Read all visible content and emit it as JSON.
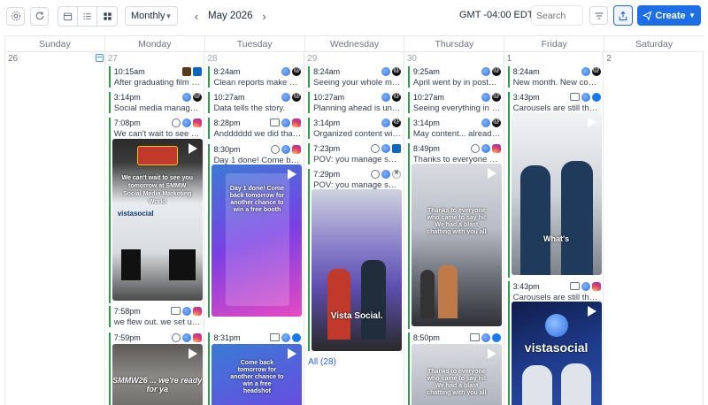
{
  "toolbar": {
    "view_select": "Monthly",
    "month": "May 2026",
    "timezone": "GMT -04:00 EDT",
    "search_placeholder": "Search",
    "create_label": "Create"
  },
  "weekdays": [
    "Sunday",
    "Monday",
    "Tuesday",
    "Wednesday",
    "Thursday",
    "Friday",
    "Saturday"
  ],
  "days": [
    {
      "num": "26",
      "posts": []
    },
    {
      "num": "27",
      "posts": [
        {
          "time": "10:15am",
          "text": "After graduating film scho..."
        },
        {
          "time": "3:14pm",
          "text": "Social media managers ar..."
        },
        {
          "time": "7:08pm",
          "text": "We can't wait to see you t..."
        },
        {
          "time": "7:58pm",
          "text": "we flew out. we set up. w..."
        },
        {
          "time": "7:59pm",
          "text": ""
        }
      ]
    },
    {
      "num": "28",
      "posts": [
        {
          "time": "8:24am",
          "text": "Clean reports make you lo..."
        },
        {
          "time": "10:27am",
          "text": "Data tells the story."
        },
        {
          "time": "8:28pm",
          "text": "Andddddd we did that #S..."
        },
        {
          "time": "8:30pm",
          "text": "Day 1 done! Come back to..."
        },
        {
          "time": "8:31pm",
          "text": ""
        }
      ]
    },
    {
      "num": "29",
      "posts": [
        {
          "time": "8:24am",
          "text": "Seeing your whole month ..."
        },
        {
          "time": "10:27am",
          "text": "Planning ahead is underra..."
        },
        {
          "time": "3:14pm",
          "text": "Organized content wins."
        },
        {
          "time": "7:23pm",
          "text": "POV: you manage so man..."
        },
        {
          "time": "7:29pm",
          "text": "POV: you manage so man..."
        }
      ],
      "all_link": "All (28)"
    },
    {
      "num": "30",
      "posts": [
        {
          "time": "9:25am",
          "text": "April went by in posts, me..."
        },
        {
          "time": "10:27am",
          "text": "Seeing everything in one ..."
        },
        {
          "time": "3:14pm",
          "text": "May content... already sch..."
        },
        {
          "time": "8:49pm",
          "text": "Thanks to everyone who c..."
        },
        {
          "time": "8:50pm",
          "text": ""
        }
      ]
    },
    {
      "num": "1",
      "posts": [
        {
          "time": "8:24am",
          "text": "New month. New content ..."
        },
        {
          "time": "3:43pm",
          "text": "Carousels are still the mo..."
        },
        {
          "time": "3:43pm",
          "text": "Carousels are still the mo..."
        }
      ]
    },
    {
      "num": "2",
      "posts": []
    }
  ],
  "thumb_text": {
    "mon_booth": "We can't wait to see you tomorrow at SMMW Social Media Marketing World",
    "mon_sign": "vistasocial",
    "mon_bottom": "SMMW26 ... we're ready for ya",
    "tue_a": "Day 1 done! Come back tomorrow for another chance to win a free booth",
    "tue_b": "Come back tomorrow for another chance to win a free headshot",
    "wed_cap": "Vista Social.",
    "thu_a": "Thanks to everyone who came to say hi! We had a blast chatting with you all",
    "thu_b": "Thanks to everyone who came to say hi! We had a blast chatting with you all",
    "fri_cap": "What's",
    "fri_logo": "vistasocial"
  },
  "colors": {
    "accent": "#1d6fe8",
    "post_bar": "#2e9e4f",
    "link": "#2563eb"
  }
}
